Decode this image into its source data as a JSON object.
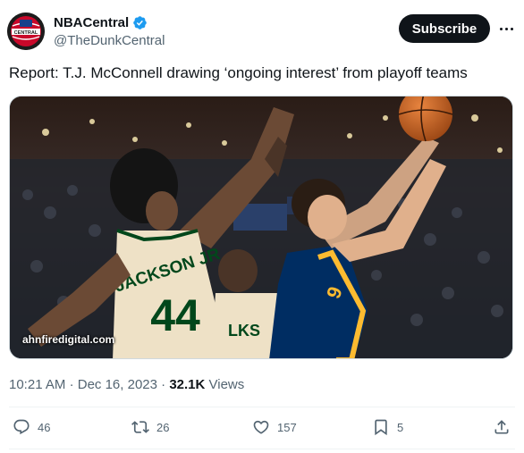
{
  "author": {
    "display_name": "NBACentral",
    "handle": "@TheDunkCentral",
    "avatar_text": "CENTRAL"
  },
  "subscribe_label": "Subscribe",
  "tweet": {
    "text": "Report: T.J. McConnell drawing ‘ongoing interest’ from playoff teams",
    "media_watermark": "ahnfiredigital.com",
    "time": "10:21 AM",
    "separator": "·",
    "date": "Dec 16, 2023",
    "views_count": "32.1K",
    "views_label": "Views"
  },
  "actions": {
    "replies": "46",
    "retweets": "26",
    "likes": "157",
    "bookmarks": "5"
  },
  "colors": {
    "verified": "#1d9bf0",
    "primary_text": "#0f1419",
    "secondary_text": "#536471",
    "bucks_green": "#00471b",
    "pacers_navy": "#002d62",
    "pacers_gold": "#fdbb30"
  },
  "icons": [
    "verified-badge-icon",
    "more-options-icon",
    "reply-icon",
    "retweet-icon",
    "like-icon",
    "bookmark-icon",
    "share-icon"
  ]
}
